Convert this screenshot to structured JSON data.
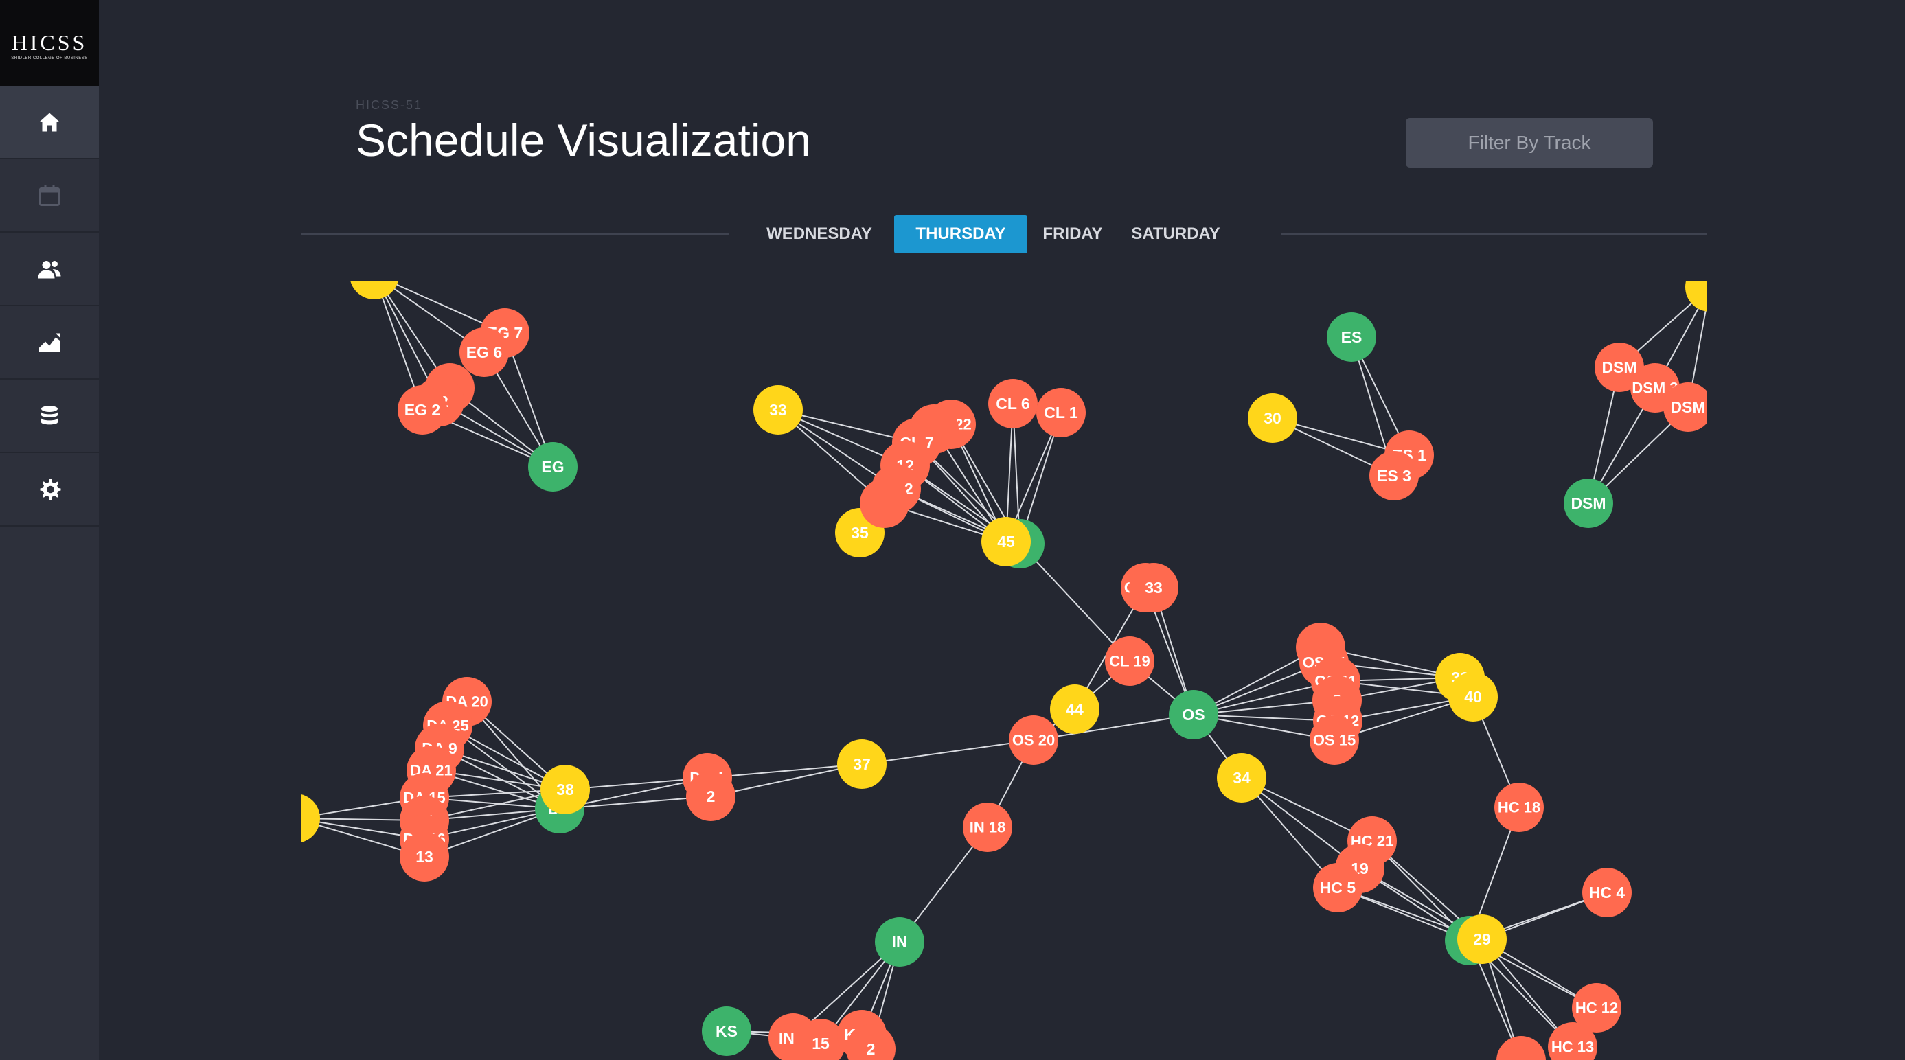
{
  "sidebar": {
    "logo_text": "HICSS",
    "logo_sub": "SHIDLER COLLEGE OF BUSINESS",
    "items": [
      {
        "icon": "home-icon",
        "active": true
      },
      {
        "icon": "calendar-icon",
        "active": false
      },
      {
        "icon": "users-icon",
        "active": false
      },
      {
        "icon": "chart-icon",
        "active": false
      },
      {
        "icon": "database-icon",
        "active": false
      },
      {
        "icon": "gear-icon",
        "active": false
      }
    ]
  },
  "header": {
    "subtitle": "HICSS-51",
    "title": "Schedule Visualization",
    "filter_label": "Filter By Track"
  },
  "tabs": [
    {
      "label": "WEDNESDAY",
      "active": false
    },
    {
      "label": "THURSDAY",
      "active": true
    },
    {
      "label": "FRIDAY",
      "active": false
    },
    {
      "label": "SATURDAY",
      "active": false
    }
  ],
  "colors": {
    "track": "#3db36b",
    "session": "#ff6a4f",
    "time": "#ffd61a",
    "edge": "#d9dbe0",
    "accent": "#1c97d0"
  },
  "graph": {
    "nodes": [
      {
        "id": "y_eg",
        "t": "time",
        "label": ""
      },
      {
        "id": "EG",
        "t": "track",
        "label": "EG"
      },
      {
        "id": "EG7",
        "t": "session",
        "label": "EG 7"
      },
      {
        "id": "EG6",
        "t": "session",
        "label": "EG 6"
      },
      {
        "id": "EG11",
        "t": "session",
        "label": "11"
      },
      {
        "id": "EG12",
        "t": "session",
        "label": "12"
      },
      {
        "id": "EG2",
        "t": "session",
        "label": "EG 2"
      },
      {
        "id": "t33",
        "t": "time",
        "label": "33"
      },
      {
        "id": "t35",
        "t": "time",
        "label": "35"
      },
      {
        "id": "CLt",
        "t": "track",
        "label": ""
      },
      {
        "id": "t45",
        "t": "time",
        "label": "45"
      },
      {
        "id": "CL22",
        "t": "session",
        "label": "CL 22"
      },
      {
        "id": "CLx1",
        "t": "session",
        "label": ""
      },
      {
        "id": "CL7",
        "t": "session",
        "label": "CL 7"
      },
      {
        "id": "CL12",
        "t": "session",
        "label": "12"
      },
      {
        "id": "CL2",
        "t": "session",
        "label": "CL 2"
      },
      {
        "id": "CLx2",
        "t": "session",
        "label": ""
      },
      {
        "id": "CL6",
        "t": "session",
        "label": "CL 6"
      },
      {
        "id": "CL1",
        "t": "session",
        "label": "CL 1"
      },
      {
        "id": "ES",
        "t": "track",
        "label": "ES"
      },
      {
        "id": "t30",
        "t": "time",
        "label": "30"
      },
      {
        "id": "ES1",
        "t": "session",
        "label": "ES 1"
      },
      {
        "id": "ES3",
        "t": "session",
        "label": "ES 3"
      },
      {
        "id": "DSM",
        "t": "track",
        "label": "DSM"
      },
      {
        "id": "y_dsm",
        "t": "time",
        "label": ""
      },
      {
        "id": "DSM1",
        "t": "session",
        "label": "DSM"
      },
      {
        "id": "DSM3",
        "t": "session",
        "label": "DSM 3"
      },
      {
        "id": "DSM4",
        "t": "session",
        "label": "DSM"
      },
      {
        "id": "OS17",
        "t": "session",
        "label": "OS 17"
      },
      {
        "id": "OS33",
        "t": "session",
        "label": "33"
      },
      {
        "id": "CL19",
        "t": "session",
        "label": "CL 19"
      },
      {
        "id": "t44",
        "t": "time",
        "label": "44"
      },
      {
        "id": "OS",
        "t": "track",
        "label": "OS"
      },
      {
        "id": "OS20",
        "t": "session",
        "label": "OS 20"
      },
      {
        "id": "t37",
        "t": "time",
        "label": "37"
      },
      {
        "id": "OSa",
        "t": "session",
        "label": "S"
      },
      {
        "id": "OS14",
        "t": "session",
        "label": "OS 14"
      },
      {
        "id": "OS11",
        "t": "session",
        "label": "OS 11"
      },
      {
        "id": "OS3",
        "t": "session",
        "label": "3"
      },
      {
        "id": "OS12",
        "t": "session",
        "label": "OS 12"
      },
      {
        "id": "OS15",
        "t": "session",
        "label": "OS 15"
      },
      {
        "id": "t36",
        "t": "time",
        "label": "36"
      },
      {
        "id": "t40",
        "t": "time",
        "label": "40"
      },
      {
        "id": "t34",
        "t": "time",
        "label": "34"
      },
      {
        "id": "DA1",
        "t": "session",
        "label": "DA 1"
      },
      {
        "id": "DA2",
        "t": "session",
        "label": "2"
      },
      {
        "id": "DAt",
        "t": "track",
        "label": "DA"
      },
      {
        "id": "t38",
        "t": "time",
        "label": "38"
      },
      {
        "id": "y_da",
        "t": "time",
        "label": ""
      },
      {
        "id": "DA20",
        "t": "session",
        "label": "DA 20"
      },
      {
        "id": "DA25",
        "t": "session",
        "label": "DA 25"
      },
      {
        "id": "DA9",
        "t": "session",
        "label": "DA 9"
      },
      {
        "id": "DA21",
        "t": "session",
        "label": "DA 21"
      },
      {
        "id": "DA15",
        "t": "session",
        "label": "DA 15"
      },
      {
        "id": "DA14",
        "t": "session",
        "label": "14"
      },
      {
        "id": "DA16",
        "t": "session",
        "label": "DA 16"
      },
      {
        "id": "DA13",
        "t": "session",
        "label": "13"
      },
      {
        "id": "IN18",
        "t": "session",
        "label": "IN 18"
      },
      {
        "id": "IN",
        "t": "track",
        "label": "IN"
      },
      {
        "id": "KS",
        "t": "track",
        "label": "KS"
      },
      {
        "id": "IN2",
        "t": "session",
        "label": "IN 2"
      },
      {
        "id": "INx",
        "t": "session",
        "label": "15"
      },
      {
        "id": "KS2",
        "t": "session",
        "label": "KS 2"
      },
      {
        "id": "KS2b",
        "t": "session",
        "label": "2"
      },
      {
        "id": "HC18",
        "t": "session",
        "label": "HC 18"
      },
      {
        "id": "HC21",
        "t": "session",
        "label": "HC 21"
      },
      {
        "id": "HC19",
        "t": "session",
        "label": "19"
      },
      {
        "id": "HC5",
        "t": "session",
        "label": "HC 5"
      },
      {
        "id": "HCt",
        "t": "track",
        "label": ""
      },
      {
        "id": "t29",
        "t": "time",
        "label": "29"
      },
      {
        "id": "HC4",
        "t": "session",
        "label": "HC 4"
      },
      {
        "id": "HC12",
        "t": "session",
        "label": "HC 12"
      },
      {
        "id": "HC13",
        "t": "session",
        "label": "HC 13"
      },
      {
        "id": "HCx",
        "t": "session",
        "label": ""
      }
    ],
    "edges": [
      [
        "y_eg",
        "EG7"
      ],
      [
        "y_eg",
        "EG6"
      ],
      [
        "y_eg",
        "EG11"
      ],
      [
        "y_eg",
        "EG12"
      ],
      [
        "y_eg",
        "EG2"
      ],
      [
        "EG",
        "EG7"
      ],
      [
        "EG",
        "EG6"
      ],
      [
        "EG",
        "EG11"
      ],
      [
        "EG",
        "EG12"
      ],
      [
        "EG",
        "EG2"
      ],
      [
        "t33",
        "CL7"
      ],
      [
        "t33",
        "CL12"
      ],
      [
        "t33",
        "CL2"
      ],
      [
        "t33",
        "CLx2"
      ],
      [
        "t35",
        "CL2"
      ],
      [
        "t35",
        "CLx2"
      ],
      [
        "t35",
        "CL12"
      ],
      [
        "t45",
        "CL22"
      ],
      [
        "t45",
        "CLx1"
      ],
      [
        "t45",
        "CL7"
      ],
      [
        "t45",
        "CL12"
      ],
      [
        "t45",
        "CL2"
      ],
      [
        "t45",
        "CLx2"
      ],
      [
        "t45",
        "CL6"
      ],
      [
        "t45",
        "CL1"
      ],
      [
        "CLt",
        "CL22"
      ],
      [
        "CLt",
        "CL7"
      ],
      [
        "CLt",
        "CL6"
      ],
      [
        "CLt",
        "CL1"
      ],
      [
        "CLt",
        "CL12"
      ],
      [
        "CLt",
        "CL2"
      ],
      [
        "CLt",
        "CL19"
      ],
      [
        "ES",
        "ES1"
      ],
      [
        "ES",
        "ES3"
      ],
      [
        "t30",
        "ES1"
      ],
      [
        "t30",
        "ES3"
      ],
      [
        "DSM",
        "DSM1"
      ],
      [
        "DSM",
        "DSM3"
      ],
      [
        "DSM",
        "DSM4"
      ],
      [
        "y_dsm",
        "DSM1"
      ],
      [
        "y_dsm",
        "DSM3"
      ],
      [
        "y_dsm",
        "DSM4"
      ],
      [
        "OS",
        "OS17"
      ],
      [
        "OS",
        "OS33"
      ],
      [
        "OS",
        "CL19"
      ],
      [
        "OS",
        "OS20"
      ],
      [
        "OS",
        "OSa"
      ],
      [
        "OS",
        "OS14"
      ],
      [
        "OS",
        "OS11"
      ],
      [
        "OS",
        "OS3"
      ],
      [
        "OS",
        "OS12"
      ],
      [
        "OS",
        "OS15"
      ],
      [
        "t44",
        "OS17"
      ],
      [
        "t44",
        "CL19"
      ],
      [
        "t44",
        "OS20"
      ],
      [
        "t36",
        "OSa"
      ],
      [
        "t36",
        "OS14"
      ],
      [
        "t36",
        "OS11"
      ],
      [
        "t36",
        "OS3"
      ],
      [
        "t40",
        "OS12"
      ],
      [
        "t40",
        "OS15"
      ],
      [
        "t40",
        "OS11"
      ],
      [
        "t34",
        "OS"
      ],
      [
        "t37",
        "OS20"
      ],
      [
        "t37",
        "DA1"
      ],
      [
        "t37",
        "DA2"
      ],
      [
        "OS20",
        "IN18"
      ],
      [
        "IN18",
        "IN"
      ],
      [
        "DAt",
        "DA1"
      ],
      [
        "DAt",
        "DA2"
      ],
      [
        "t38",
        "DA1"
      ],
      [
        "DAt",
        "DA20"
      ],
      [
        "DAt",
        "DA25"
      ],
      [
        "DAt",
        "DA9"
      ],
      [
        "DAt",
        "DA21"
      ],
      [
        "DAt",
        "DA15"
      ],
      [
        "DAt",
        "DA14"
      ],
      [
        "DAt",
        "DA16"
      ],
      [
        "DAt",
        "DA13"
      ],
      [
        "t38",
        "DA20"
      ],
      [
        "t38",
        "DA25"
      ],
      [
        "t38",
        "DA9"
      ],
      [
        "t38",
        "DA21"
      ],
      [
        "t38",
        "DA15"
      ],
      [
        "t38",
        "DA14"
      ],
      [
        "y_da",
        "DA15"
      ],
      [
        "y_da",
        "DA14"
      ],
      [
        "y_da",
        "DA16"
      ],
      [
        "y_da",
        "DA13"
      ],
      [
        "IN",
        "IN2"
      ],
      [
        "IN",
        "INx"
      ],
      [
        "IN",
        "KS2"
      ],
      [
        "IN",
        "KS2b"
      ],
      [
        "KS",
        "IN2"
      ],
      [
        "KS",
        "KS2"
      ],
      [
        "t40",
        "HC18"
      ],
      [
        "HC18",
        "HCt"
      ],
      [
        "t34",
        "HC21"
      ],
      [
        "t34",
        "HC19"
      ],
      [
        "t34",
        "HC5"
      ],
      [
        "HCt",
        "HC21"
      ],
      [
        "HCt",
        "HC19"
      ],
      [
        "HCt",
        "HC5"
      ],
      [
        "t29",
        "HC21"
      ],
      [
        "t29",
        "HC19"
      ],
      [
        "t29",
        "HC5"
      ],
      [
        "t29",
        "HC4"
      ],
      [
        "HCt",
        "HC4"
      ],
      [
        "t29",
        "HC12"
      ],
      [
        "t29",
        "HC13"
      ],
      [
        "HCt",
        "HC12"
      ],
      [
        "HCt",
        "HC13"
      ],
      [
        "t29",
        "HCx"
      ],
      [
        "HCt",
        "HCx"
      ]
    ]
  }
}
